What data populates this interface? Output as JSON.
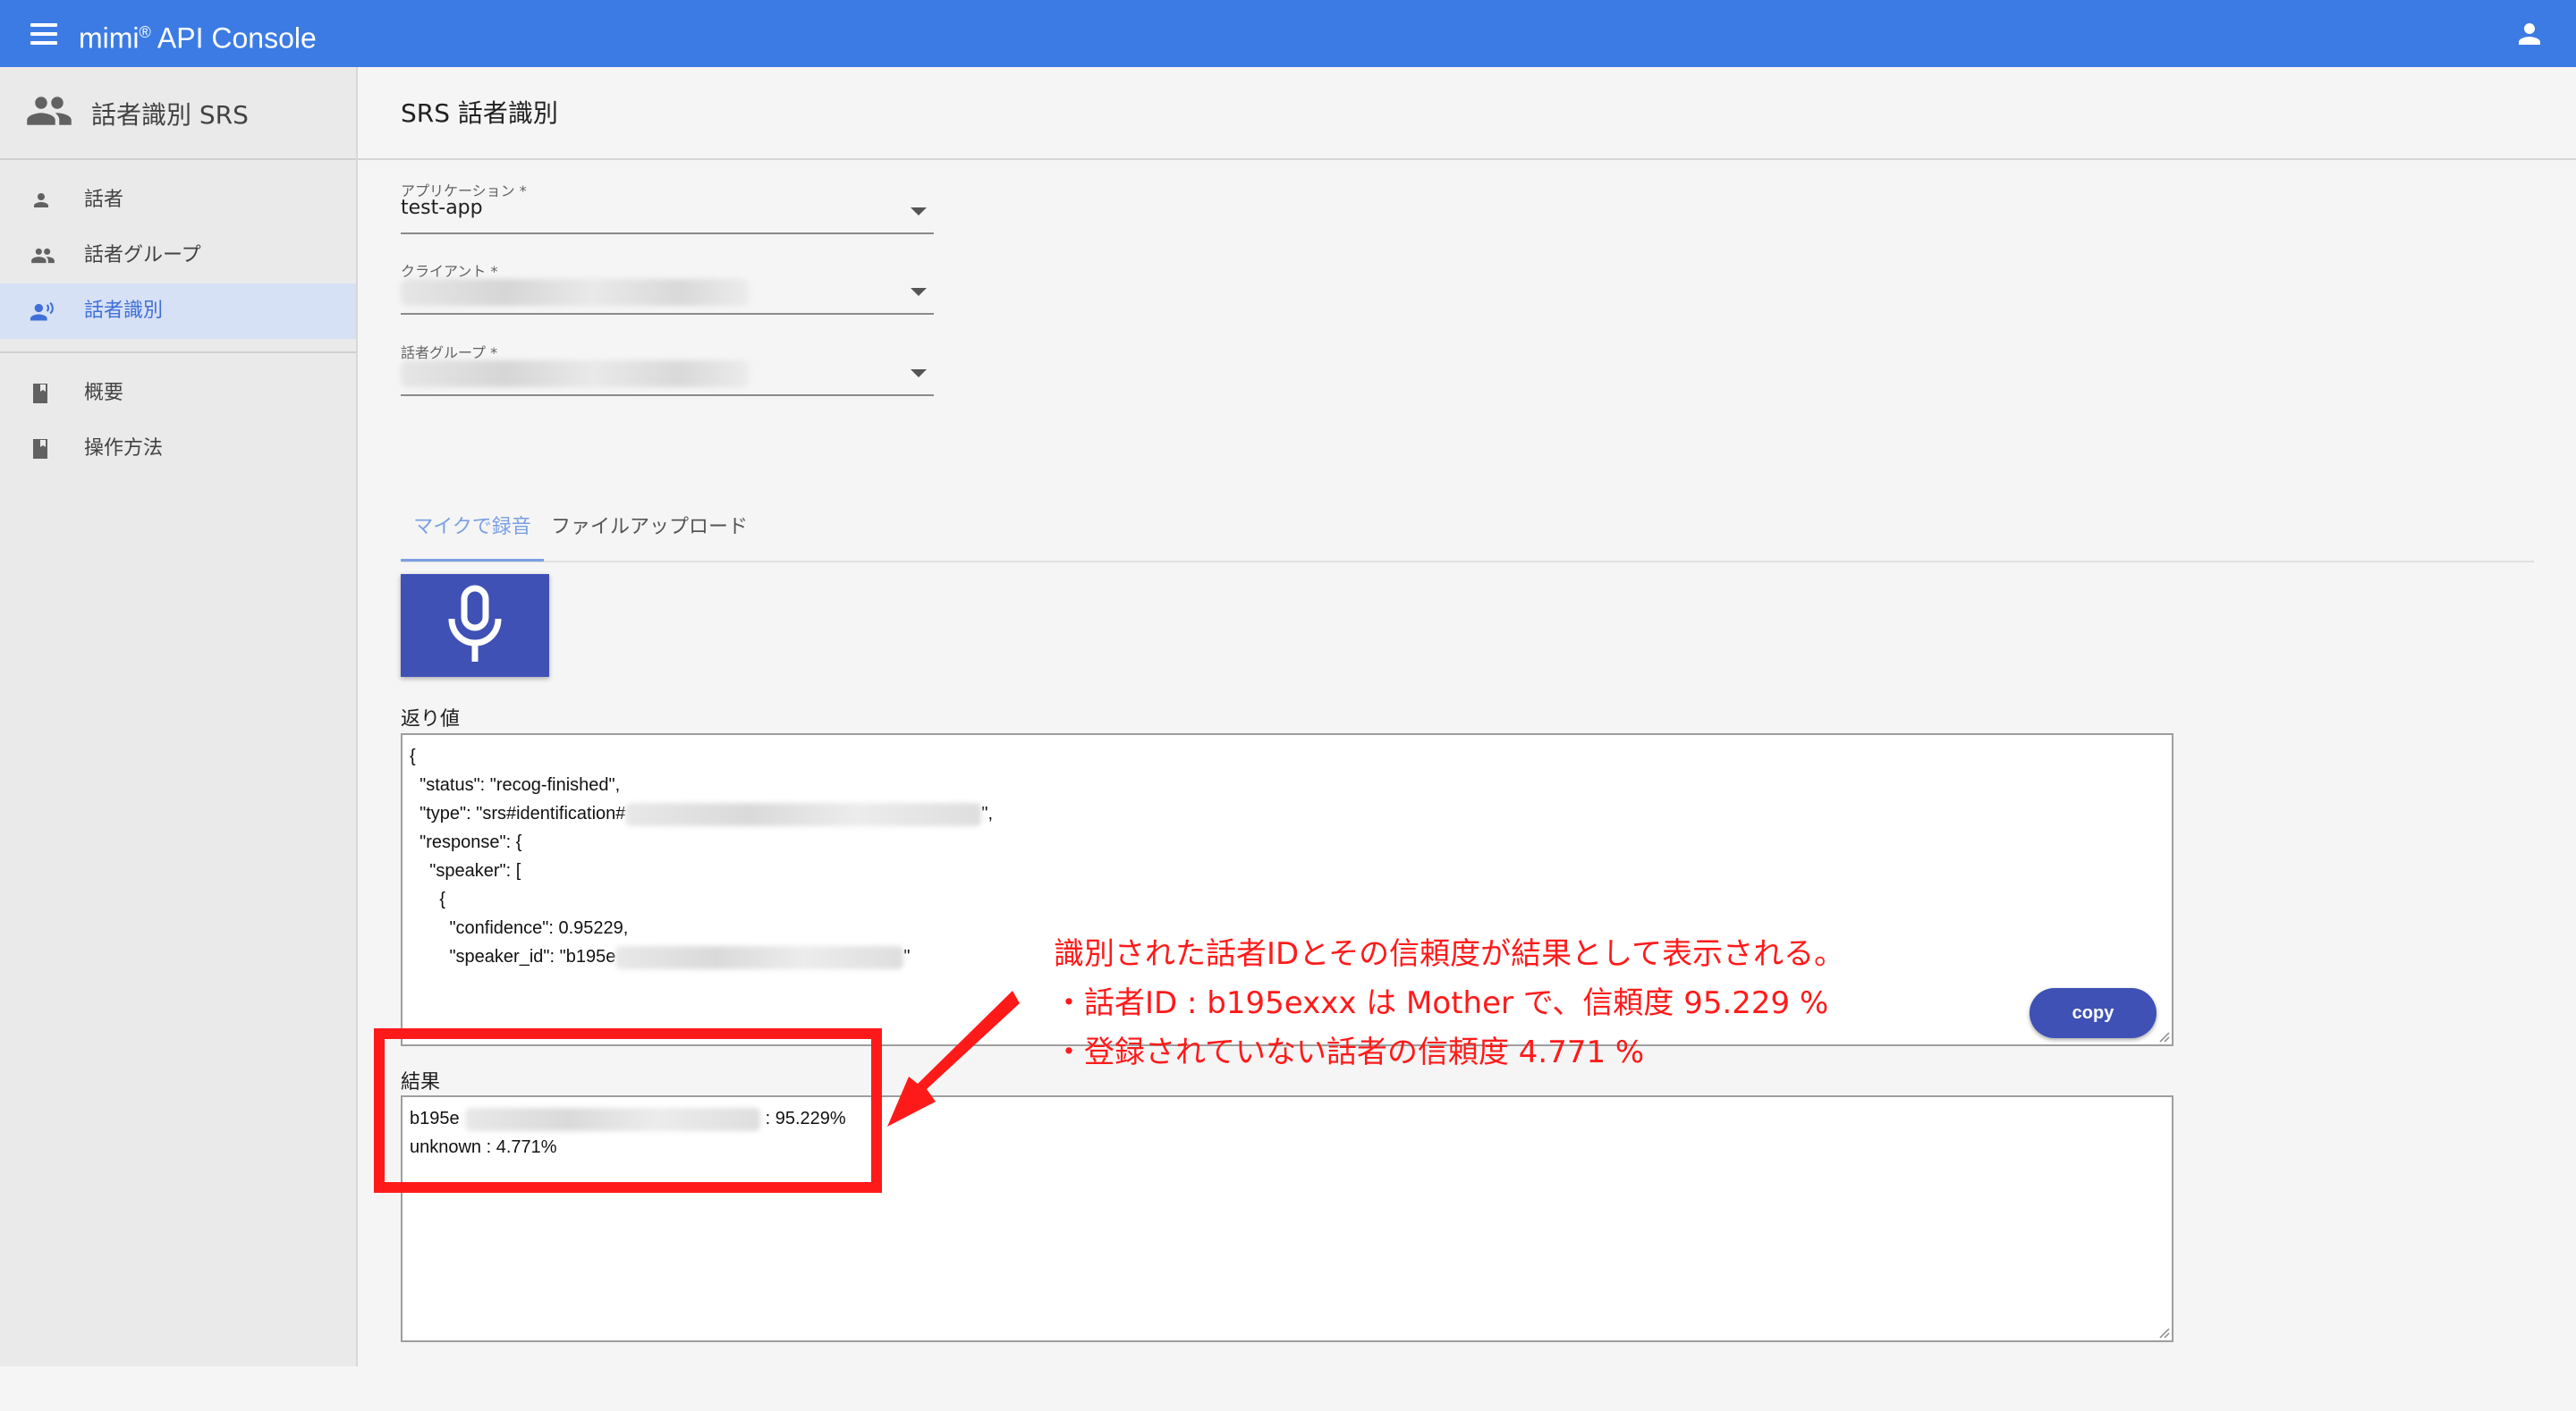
{
  "appbar": {
    "title_prefix": "mimi",
    "title_sup": "®",
    "title_suffix": "API Console",
    "bg_color": "#3c7be4"
  },
  "sidebar": {
    "header": "話者識別 SRS",
    "items": [
      {
        "label": "話者",
        "icon": "person-icon"
      },
      {
        "label": "話者グループ",
        "icon": "people-icon"
      },
      {
        "label": "話者識別",
        "icon": "voice-recognition-icon",
        "active": true
      },
      {
        "label": "概要",
        "icon": "book-icon"
      },
      {
        "label": "操作方法",
        "icon": "book-icon"
      }
    ]
  },
  "main": {
    "title": "SRS 話者識別",
    "fields": {
      "application": {
        "label": "アプリケーション *",
        "value": "test-app"
      },
      "client": {
        "label": "クライアント *",
        "value": ""
      },
      "group": {
        "label": "話者グループ *",
        "value": ""
      }
    },
    "tabs": [
      "マイクで録音",
      "ファイルアップロード"
    ],
    "return_label": "返り値",
    "json_lines": [
      "{",
      "  \"status\": \"recog-finished\",",
      "  \"type\": \"srs#identification#",
      "\",",
      "  \"response\": {",
      "    \"speaker\": [",
      "      {",
      "        \"confidence\": 0.95229,",
      "        \"speaker_id\": \"b195e",
      "\""
    ],
    "copy_label": "copy",
    "result_label": "結果",
    "result_lines": {
      "line1_prefix": "b195e",
      "line1_suffix": ": 95.229%",
      "line2": "unknown : 4.771%"
    }
  },
  "annotation": {
    "line1": "識別された話者IDとその信頼度が結果として表示される。",
    "line2": "・話者ID : b195exxx は Mother で、信頼度 95.229 %",
    "line3": "・登録されていない話者の信頼度 4.771 %",
    "color": "#ff1a1a"
  }
}
